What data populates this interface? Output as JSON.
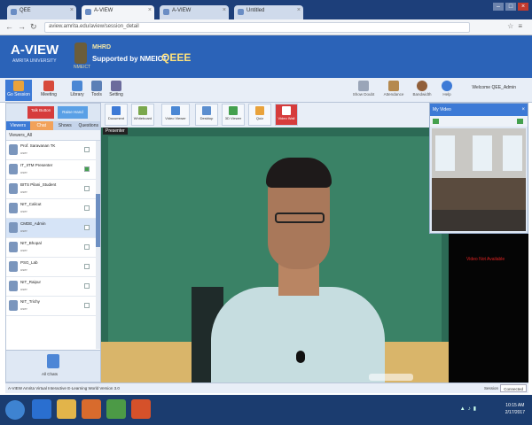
{
  "browser": {
    "tabs": [
      {
        "label": "QEE"
      },
      {
        "label": "A-VIEW"
      },
      {
        "label": "A-VIEW"
      },
      {
        "label": "Untitled"
      }
    ],
    "url": "aview.amrita.edu/aview/session_detail"
  },
  "header": {
    "logo": "A-VIEW",
    "logo_sub": "AMRITA UNIVERSITY",
    "emblem_text": "NMEICT",
    "mooc_label": "MHRD",
    "support_text": "Supported by NMEICT",
    "course_code": "QEEE"
  },
  "toolbar": {
    "items": [
      {
        "label": "Go Session",
        "color": "#e9a23b"
      },
      {
        "label": "Meeting",
        "color": "#d74a3c"
      },
      {
        "label": "Library",
        "color": "#4a87d4"
      },
      {
        "label": "Tools",
        "color": "#5b7fb6"
      },
      {
        "label": "Setting",
        "color": "#6b6b9c"
      }
    ],
    "right_items": [
      {
        "label": "Show Doubt",
        "color": "#9aa5b8"
      },
      {
        "label": "Attendance",
        "color": "#b5894e"
      },
      {
        "label": "Bandwidth",
        "color": "#915f3a"
      },
      {
        "label": "Help",
        "color": "#3d7ad6"
      }
    ],
    "welcome": "Welcome QEE_Admin"
  },
  "left_panel": {
    "btn_red": "Talk Button",
    "btn_blue": "Raise Hand",
    "tabs": [
      "Viewers",
      "Chat",
      "Shows",
      "Questions"
    ],
    "header": "Viewers_All",
    "users": [
      {
        "name": "Prof. Saravanan TK",
        "sub": "user"
      },
      {
        "name": "IT_IITM Presenter",
        "sub": "user"
      },
      {
        "name": "BITS Pilani_Student",
        "sub": "user"
      },
      {
        "name": "NIT_Calicut",
        "sub": "user"
      },
      {
        "name": "CMDE_Admin",
        "sub": "user"
      },
      {
        "name": "NIT_Bhopal",
        "sub": "user"
      },
      {
        "name": "PSG_Lab",
        "sub": "user"
      },
      {
        "name": "NIT_Raipur",
        "sub": "user"
      },
      {
        "name": "NIT_Trichy",
        "sub": "user"
      }
    ],
    "bottom_label": "All Chats"
  },
  "content_toolbar": {
    "items": [
      {
        "label": "Document",
        "color": "#3d7ad6"
      },
      {
        "label": "Whiteboard",
        "color": "#7aa84d"
      },
      {
        "label": "Video Viewer",
        "color": "#4a87d4"
      },
      {
        "label": "Desktop",
        "color": "#5b8ecf"
      },
      {
        "label": "3D Viewer",
        "color": "#44a04e"
      },
      {
        "label": "Quiz",
        "color": "#e9a23b"
      },
      {
        "label": "Video Wall",
        "color": "#ffffff"
      }
    ]
  },
  "video": {
    "presenter_label": "Presenter"
  },
  "my_video": {
    "title": "My Video"
  },
  "black_panel": {
    "text": "Video Not Available"
  },
  "status": {
    "left": "A-VIEW Amrita Virtual Interactive E-Learning World Version 3.0",
    "right": "Session",
    "connection": "Connected"
  },
  "taskbar": {
    "clock_time": "10:15 AM",
    "clock_date": "2/17/2017"
  }
}
